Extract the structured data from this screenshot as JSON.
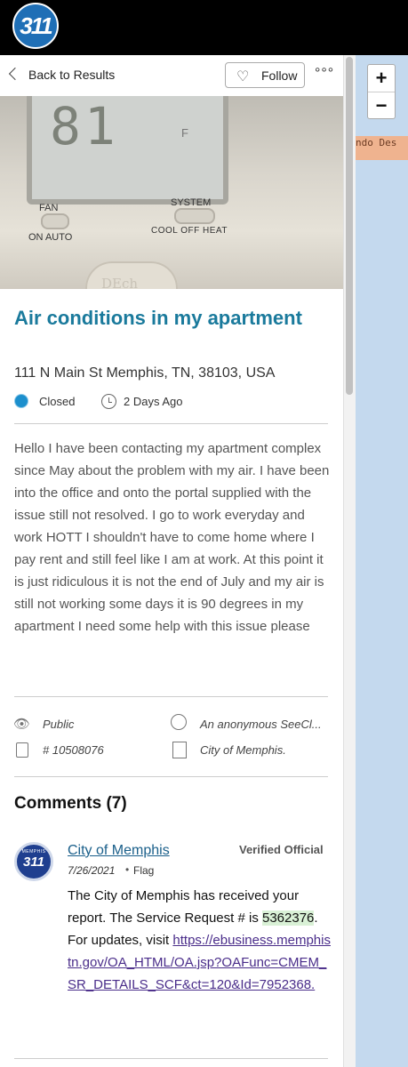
{
  "header": {
    "logo_text": "311"
  },
  "map": {
    "zoom_in": "+",
    "zoom_out": "−",
    "road_label": "ndo Des"
  },
  "nav": {
    "back_label": "Back to Results",
    "follow_label": "Follow",
    "more_label": "°°°"
  },
  "photo": {
    "display_digits": "81",
    "unit": "F",
    "fan_label": "FAN",
    "fan_options": "ON  AUTO",
    "system_label": "SYSTEM",
    "system_options": "COOL  OFF  HEAT",
    "brand": "DEch"
  },
  "report": {
    "title": "Air conditions in my apartment",
    "address": "111 N Main St Memphis, TN, 38103, USA",
    "status": "Closed",
    "age": "2 Days Ago",
    "description": "Hello I have been contacting my apartment complex since May about the problem with my air. I have been into the office and onto the portal supplied with the issue still not resolved. I go to work everyday and work HOTT I shouldn't have to come home where I pay rent and still feel like I am at work. At this point it is just ridiculous it is not the end of July and my air is still not working some days it is 90 degrees in my apartment I need some help with this issue please",
    "visibility": "Public",
    "reporter": "An anonymous SeeCl...",
    "issue_number": "# 10508076",
    "assignee": "City of Memphis."
  },
  "comments": {
    "heading": "Comments (7)",
    "items": [
      {
        "avatar_top": "MEMPHIS",
        "avatar_main": "311",
        "author": "City of Memphis",
        "badge": "Verified Official",
        "date": "7/26/2021",
        "separator": "•",
        "flag_label": "Flag",
        "body_before": "The City of Memphis has received your report. The Service Request # is ",
        "request_number": "5362376",
        "body_after": ". For updates, visit ",
        "link": "https://ebusiness.memphistn.gov/OA_HTML/OA.jsp?OAFunc=CMEM_SR_DETAILS_SCF&ct=120&Id=7952368."
      }
    ]
  }
}
